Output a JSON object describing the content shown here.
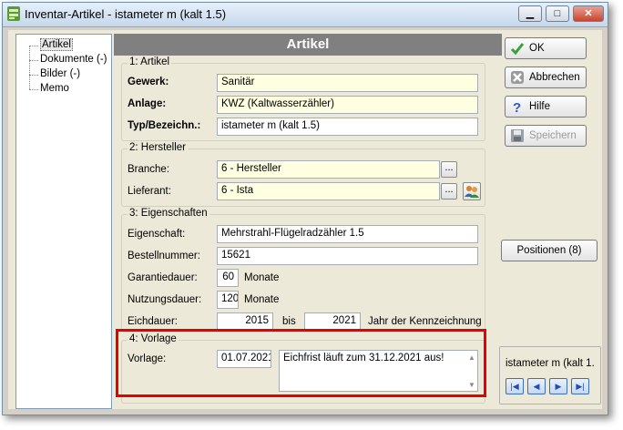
{
  "window": {
    "title": "Inventar-Artikel - istameter m (kalt 1.5)",
    "minimize_glyph": "▁",
    "maximize_glyph": "□",
    "close_glyph": "✕"
  },
  "tree": {
    "items": [
      {
        "label": "Artikel",
        "selected": true
      },
      {
        "label": "Dokumente (-)"
      },
      {
        "label": "Bilder (-)"
      },
      {
        "label": "Memo"
      }
    ]
  },
  "panel": {
    "title": "Artikel"
  },
  "artikel": {
    "group_title": "1: Artikel",
    "gewerk_label": "Gewerk:",
    "gewerk_value": "Sanitär",
    "anlage_label": "Anlage:",
    "anlage_value": "KWZ (Kaltwasserzähler)",
    "typ_label": "Typ/Bezeichn.:",
    "typ_value": "istameter m (kalt 1.5)"
  },
  "hersteller": {
    "group_title": "2: Hersteller",
    "branche_label": "Branche:",
    "branche_value": "6 - Hersteller",
    "lieferant_label": "Lieferant:",
    "lieferant_value": "6 - Ista",
    "ellipsis": "..."
  },
  "eigenschaften": {
    "group_title": "3: Eigenschaften",
    "eigenschaft_label": "Eigenschaft:",
    "eigenschaft_value": "Mehrstrahl-Flügelradzähler 1.5",
    "bestellnummer_label": "Bestellnummer:",
    "bestellnummer_value": "15621",
    "garantie_label": "Garantiedauer:",
    "garantie_value": "60",
    "garantie_unit": "Monate",
    "nutzung_label": "Nutzungsdauer:",
    "nutzung_value": "120",
    "nutzung_unit": "Monate",
    "eich_label": "Eichdauer:",
    "eich_from": "2015",
    "eich_bis": "bis",
    "eich_to": "2021",
    "eich_suffix": "Jahr der Kennzeichnung"
  },
  "vorlage": {
    "group_title": "4: Vorlage",
    "label": "Vorlage:",
    "date": "01.07.2021",
    "memo": "Eichfrist läuft zum 31.12.2021 aus!"
  },
  "buttons": {
    "ok": "OK",
    "abbrechen": "Abbrechen",
    "hilfe": "Hilfe",
    "speichern": "Speichern",
    "positionen": "Positionen (8)"
  },
  "navigator": {
    "label": "istameter m (kalt 1.",
    "first": "|◀",
    "prev": "◀",
    "next": "▶",
    "last": "▶|"
  },
  "colors": {
    "accent_header": "#808080",
    "highlight_box": "#e60000",
    "field_yellow": "#ffffe1"
  }
}
